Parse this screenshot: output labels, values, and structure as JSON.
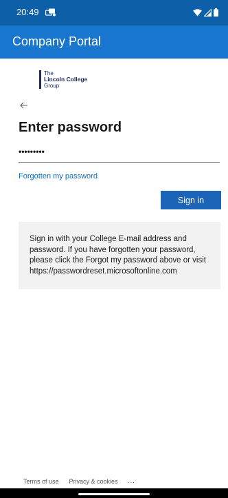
{
  "status_bar": {
    "time": "20:49",
    "notification_icon": "notification-icon",
    "icons": [
      "wifi-icon",
      "cellular-icon",
      "battery-icon"
    ]
  },
  "app_bar": {
    "title": "Company Portal",
    "color": "#1876cf"
  },
  "logo": {
    "line1": "The",
    "line2": "Lincoln College",
    "line3": "Group"
  },
  "back_icon": "back-arrow-icon",
  "signin": {
    "title": "Enter password",
    "password_value": "•••••••••",
    "forgot_link": "Forgotten my password",
    "button_label": "Sign in",
    "button_color": "#1c64b8",
    "info_text": "Sign in with your College E-mail address and password. If you have forgotten your password, please click the Forgot my password above or visit https://passwordreset.microsoftonline.com"
  },
  "footer": {
    "terms": "Terms of use",
    "privacy": "Privacy & cookies",
    "more": "..."
  }
}
